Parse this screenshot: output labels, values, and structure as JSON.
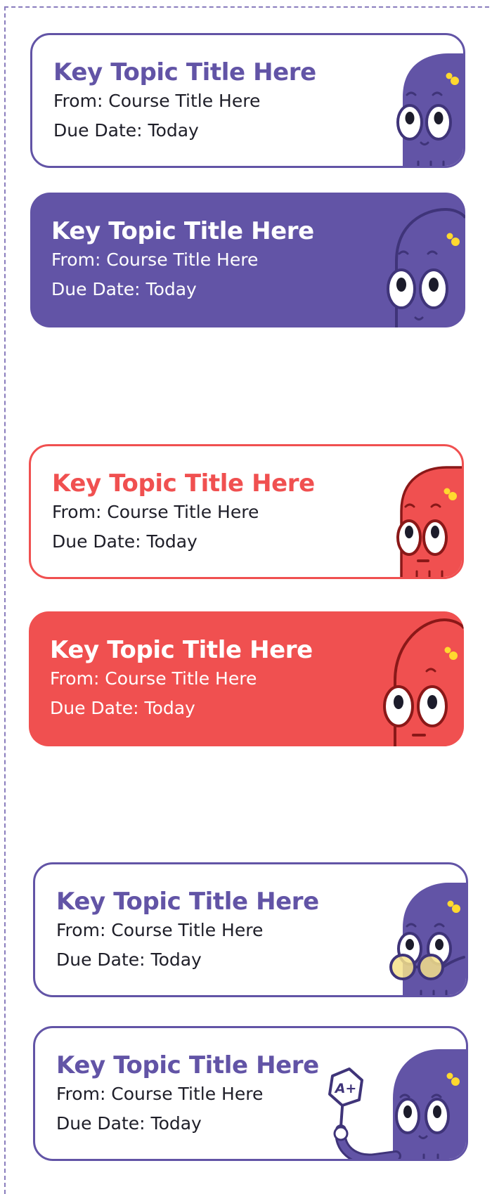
{
  "colors": {
    "purple": "#6254a6",
    "coral": "#f05050",
    "guide": "#8a7dbd"
  },
  "cards": [
    {
      "style": "outline",
      "accent": "purple",
      "mascot": "purple-monster-icon",
      "title": "Key Topic Title Here",
      "from": "From: Course Title Here",
      "due": "Due Date: Today"
    },
    {
      "style": "filled",
      "accent": "purple",
      "mascot": "purple-monster-outline-icon",
      "title": "Key Topic Title Here",
      "from": "From: Course Title Here",
      "due": "Due Date: Today"
    },
    {
      "style": "outline",
      "accent": "coral",
      "mascot": "red-monster-icon",
      "title": "Key Topic Title Here",
      "from": "From: Course Title Here",
      "due": "Due Date: Today"
    },
    {
      "style": "filled",
      "accent": "coral",
      "mascot": "red-monster-outline-icon",
      "title": "Key Topic Title Here",
      "from": "From: Course Title Here",
      "due": "Due Date: Today"
    },
    {
      "style": "outline",
      "accent": "purple",
      "mascot": "monster-with-glasses-icon",
      "title": "Key Topic Title Here",
      "from": "From: Course Title Here",
      "due": "Due Date: Today"
    },
    {
      "style": "outline",
      "accent": "purple",
      "mascot": "monster-holding-a-plus-sign-icon",
      "badge": "A+",
      "title": "Key Topic Title Here",
      "from": "From: Course Title Here",
      "due": "Due Date: Today"
    }
  ]
}
